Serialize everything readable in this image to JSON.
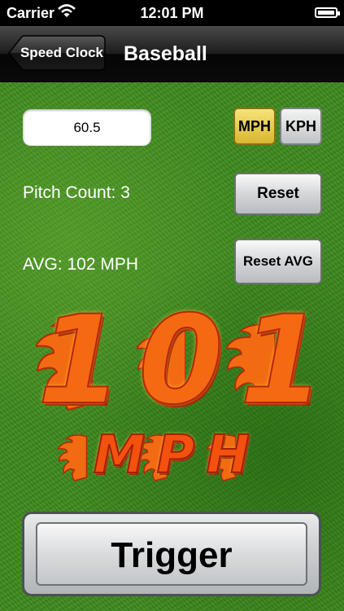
{
  "status_bar": {
    "carrier": "Carrier",
    "time": "12:01 PM"
  },
  "nav": {
    "back_label": "Speed Clock",
    "title": "Baseball"
  },
  "distance": {
    "value": "60.5"
  },
  "units": {
    "mph_label": "MPH",
    "kph_label": "KPH",
    "selected": "MPH"
  },
  "stats": {
    "pitch_count": "Pitch Count: 3",
    "average": "AVG: 102 MPH"
  },
  "buttons": {
    "reset": "Reset",
    "reset_avg": "Reset AVG",
    "trigger": "Trigger"
  },
  "display": {
    "speed": "101",
    "unit": "MPH"
  },
  "colors": {
    "grass": "#3f8a1f",
    "flame_orange": "#f46a12",
    "selected_unit": "#e6c545"
  }
}
